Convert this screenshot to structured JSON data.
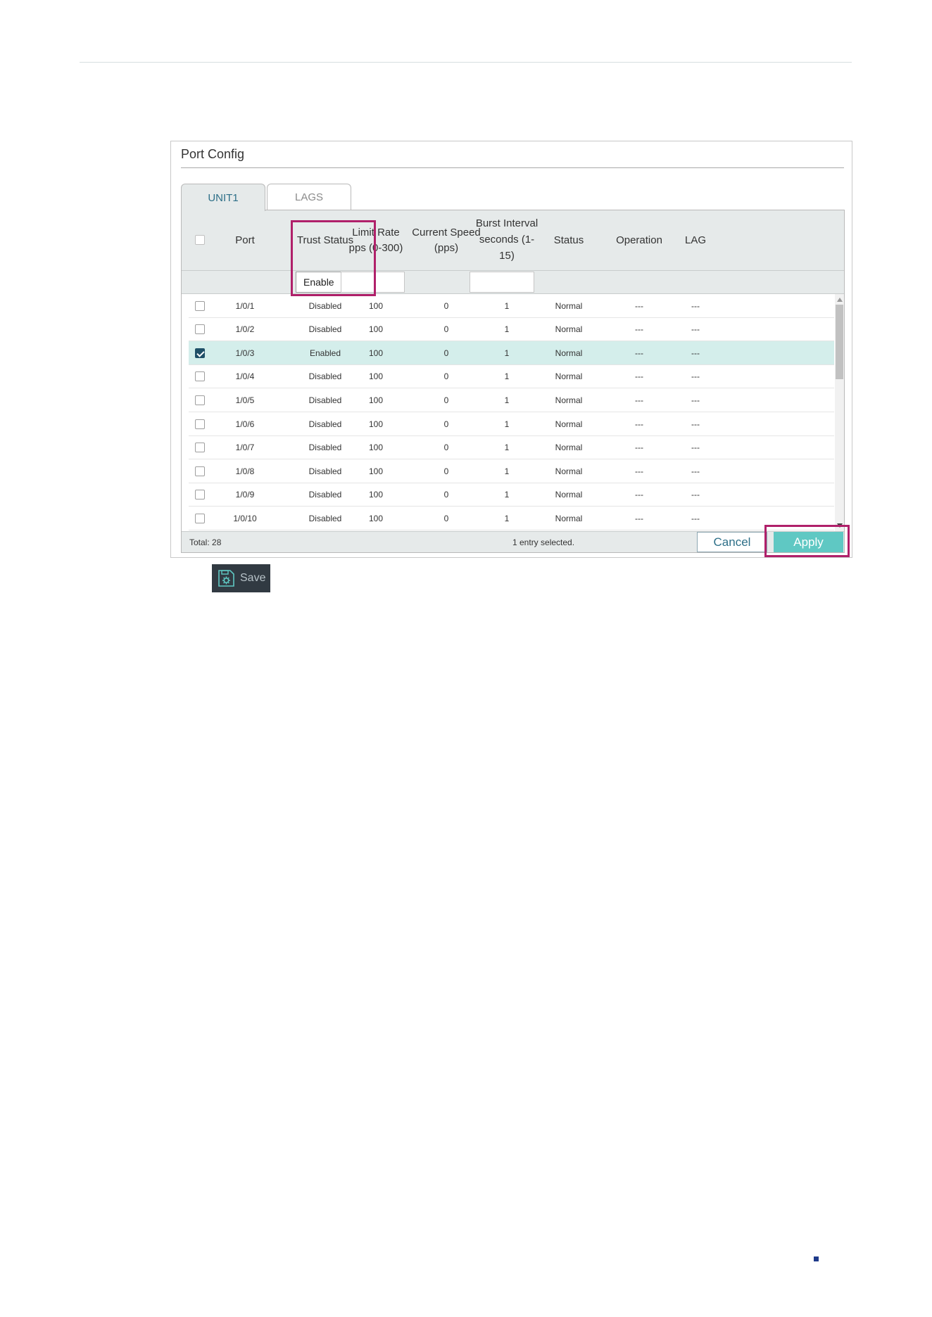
{
  "panel": {
    "title": "Port Config",
    "tabs": [
      {
        "label": "UNIT1",
        "active": true
      },
      {
        "label": "LAGS",
        "active": false
      }
    ]
  },
  "table": {
    "columns": [
      "",
      "Port",
      "Trust Status",
      "Limit Rate pps (0-300)",
      "Current Speed (pps)",
      "Burst Interval seconds (1-15)",
      "Status",
      "Operation",
      "LAG"
    ],
    "header_lines": {
      "port": "Port",
      "trust": "Trust Status",
      "limit1": "Limit Rate",
      "limit2": "pps (0-300)",
      "speed1": "Current Speed",
      "speed2": "(pps)",
      "burst1": "Burst Interval",
      "burst2": "seconds (1-",
      "burst3": "15)",
      "status": "Status",
      "operation": "Operation",
      "lag": "LAG"
    },
    "filter": {
      "trust_status_selected": "Enable"
    },
    "rows": [
      {
        "checked": false,
        "port": "1/0/1",
        "trust": "Disabled",
        "limit": "100",
        "speed": "0",
        "burst": "1",
        "status": "Normal",
        "operation": "---",
        "lag": "---"
      },
      {
        "checked": false,
        "port": "1/0/2",
        "trust": "Disabled",
        "limit": "100",
        "speed": "0",
        "burst": "1",
        "status": "Normal",
        "operation": "---",
        "lag": "---"
      },
      {
        "checked": true,
        "port": "1/0/3",
        "trust": "Enabled",
        "limit": "100",
        "speed": "0",
        "burst": "1",
        "status": "Normal",
        "operation": "---",
        "lag": "---"
      },
      {
        "checked": false,
        "port": "1/0/4",
        "trust": "Disabled",
        "limit": "100",
        "speed": "0",
        "burst": "1",
        "status": "Normal",
        "operation": "---",
        "lag": "---"
      },
      {
        "checked": false,
        "port": "1/0/5",
        "trust": "Disabled",
        "limit": "100",
        "speed": "0",
        "burst": "1",
        "status": "Normal",
        "operation": "---",
        "lag": "---"
      },
      {
        "checked": false,
        "port": "1/0/6",
        "trust": "Disabled",
        "limit": "100",
        "speed": "0",
        "burst": "1",
        "status": "Normal",
        "operation": "---",
        "lag": "---"
      },
      {
        "checked": false,
        "port": "1/0/7",
        "trust": "Disabled",
        "limit": "100",
        "speed": "0",
        "burst": "1",
        "status": "Normal",
        "operation": "---",
        "lag": "---"
      },
      {
        "checked": false,
        "port": "1/0/8",
        "trust": "Disabled",
        "limit": "100",
        "speed": "0",
        "burst": "1",
        "status": "Normal",
        "operation": "---",
        "lag": "---"
      },
      {
        "checked": false,
        "port": "1/0/9",
        "trust": "Disabled",
        "limit": "100",
        "speed": "0",
        "burst": "1",
        "status": "Normal",
        "operation": "---",
        "lag": "---"
      },
      {
        "checked": false,
        "port": "1/0/10",
        "trust": "Disabled",
        "limit": "100",
        "speed": "0",
        "burst": "1",
        "status": "Normal",
        "operation": "---",
        "lag": "---"
      }
    ]
  },
  "footer": {
    "total": "Total: 28",
    "selected_info": "1 entry selected.",
    "cancel_label": "Cancel",
    "apply_label": "Apply"
  },
  "save": {
    "label": "Save",
    "icon": "save-gear-icon"
  },
  "colors": {
    "accent": "#5fc8c3",
    "highlight_box": "#b0206a",
    "selected_row": "#d4eeeb",
    "tab_text_active": "#2d6f88"
  }
}
